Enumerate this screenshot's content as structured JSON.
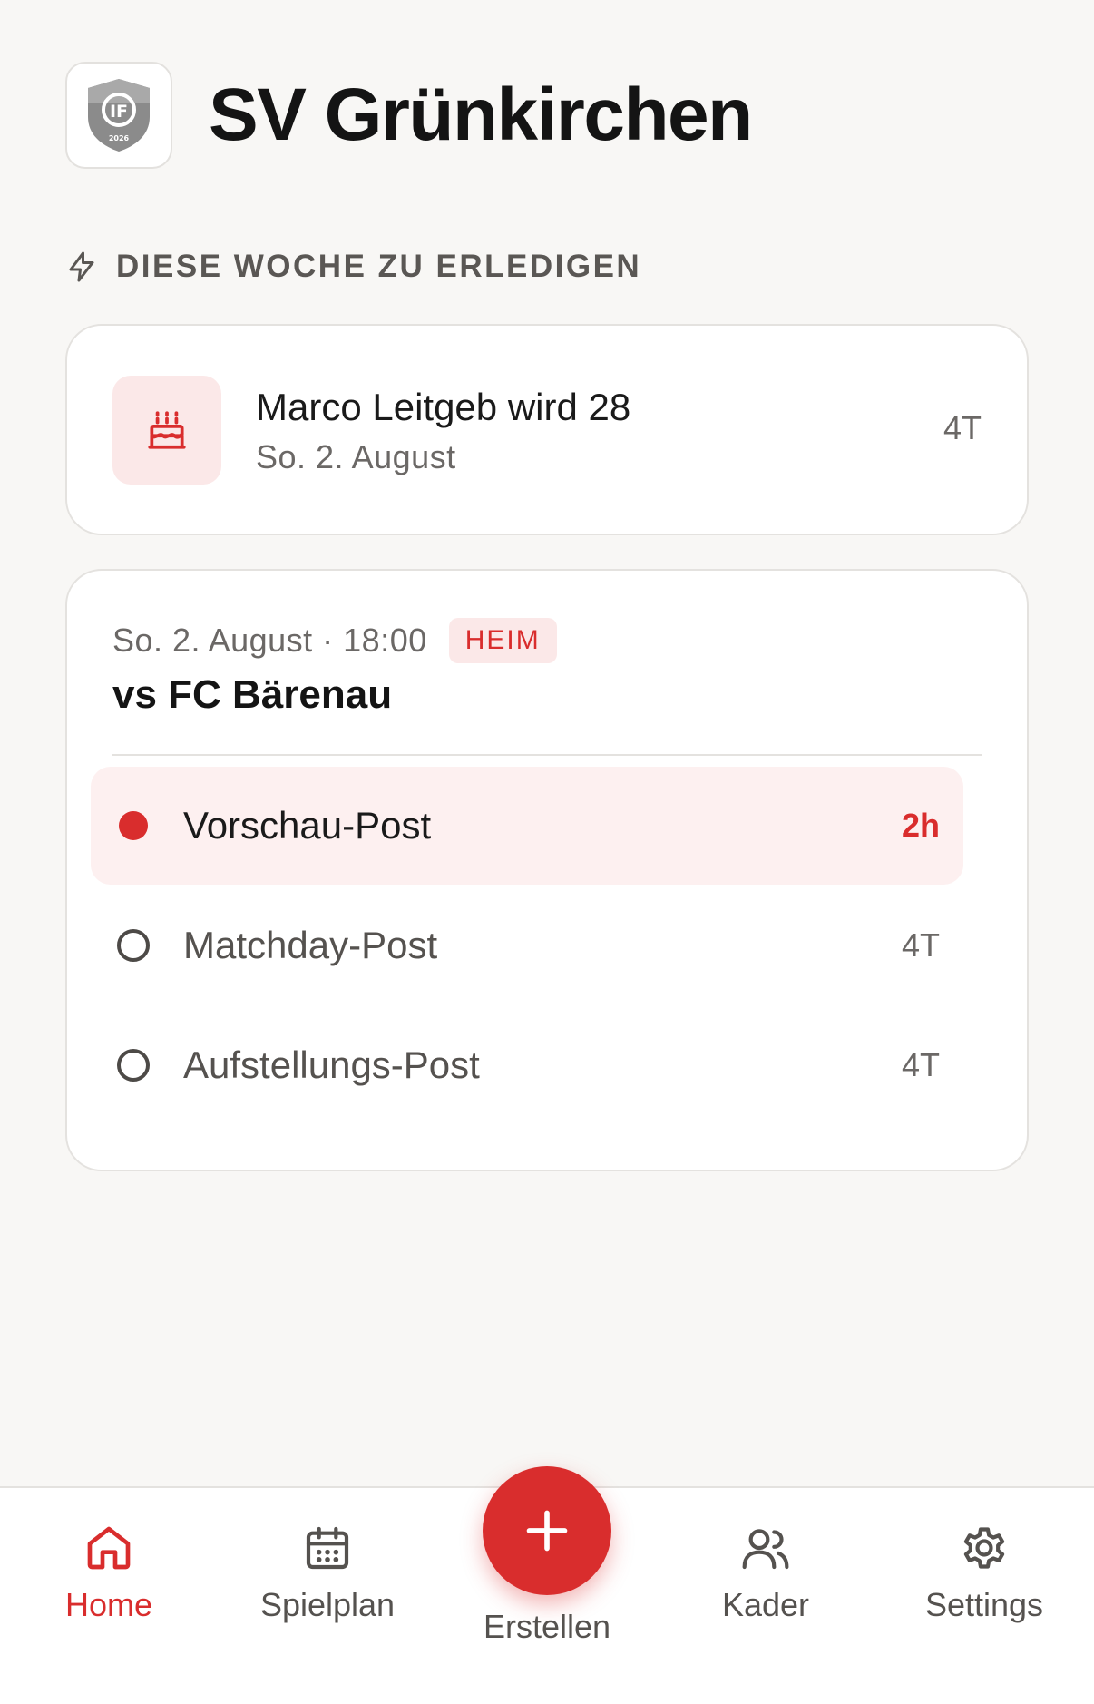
{
  "app": {
    "title": "SV Grünkirchen",
    "logo_icon": "club-crest-icon",
    "logo_text": "IF",
    "logo_year": "2026"
  },
  "section": {
    "title": "DIESE WOCHE ZU ERLEDIGEN",
    "icon": "lightning-icon"
  },
  "birthday": {
    "icon": "birthday-cake-icon",
    "title": "Marco Leitgeb wird 28",
    "date": "So. 2. August",
    "due": "4T"
  },
  "match": {
    "date_time": "So. 2. August · 18:00",
    "badge": "HEIM",
    "title": "vs FC Bärenau",
    "tasks": [
      {
        "label": "Vorschau-Post",
        "due": "2h",
        "status": "urgent"
      },
      {
        "label": "Matchday-Post",
        "due": "4T",
        "status": "open"
      },
      {
        "label": "Aufstellungs-Post",
        "due": "4T",
        "status": "open"
      }
    ]
  },
  "tabbar": {
    "items": [
      {
        "label": "Home",
        "icon": "home-icon",
        "active": true
      },
      {
        "label": "Spielplan",
        "icon": "calendar-icon",
        "active": false
      },
      {
        "label": "Erstellen",
        "icon": "plus-icon",
        "active": false
      },
      {
        "label": "Kader",
        "icon": "users-icon",
        "active": false
      },
      {
        "label": "Settings",
        "icon": "gear-icon",
        "active": false
      }
    ]
  },
  "colors": {
    "accent": "#d92d2d",
    "accent_soft": "#fbe8e8",
    "background": "#f8f7f5"
  }
}
